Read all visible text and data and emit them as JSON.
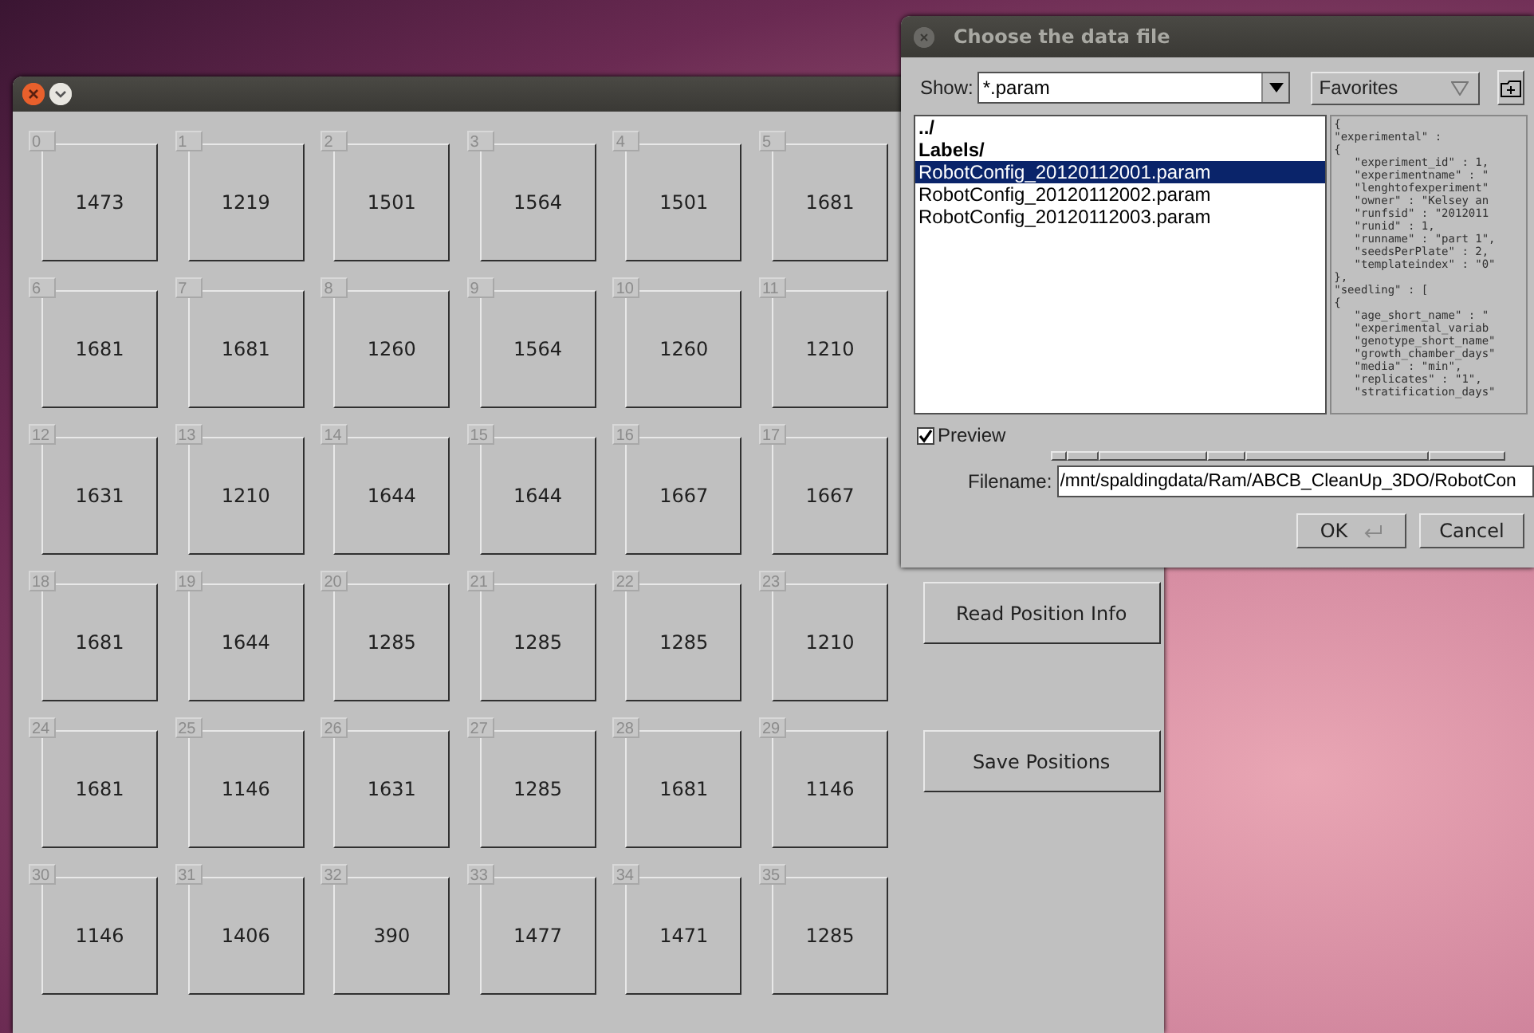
{
  "main_window": {
    "cells": [
      {
        "index": "0",
        "value": "1473"
      },
      {
        "index": "1",
        "value": "1219"
      },
      {
        "index": "2",
        "value": "1501"
      },
      {
        "index": "3",
        "value": "1564"
      },
      {
        "index": "4",
        "value": "1501"
      },
      {
        "index": "5",
        "value": "1681"
      },
      {
        "index": "6",
        "value": "1681"
      },
      {
        "index": "7",
        "value": "1681"
      },
      {
        "index": "8",
        "value": "1260"
      },
      {
        "index": "9",
        "value": "1564"
      },
      {
        "index": "10",
        "value": "1260"
      },
      {
        "index": "11",
        "value": "1210"
      },
      {
        "index": "12",
        "value": "1631"
      },
      {
        "index": "13",
        "value": "1210"
      },
      {
        "index": "14",
        "value": "1644"
      },
      {
        "index": "15",
        "value": "1644"
      },
      {
        "index": "16",
        "value": "1667"
      },
      {
        "index": "17",
        "value": "1667"
      },
      {
        "index": "18",
        "value": "1681"
      },
      {
        "index": "19",
        "value": "1644"
      },
      {
        "index": "20",
        "value": "1285"
      },
      {
        "index": "21",
        "value": "1285"
      },
      {
        "index": "22",
        "value": "1285"
      },
      {
        "index": "23",
        "value": "1210"
      },
      {
        "index": "24",
        "value": "1681"
      },
      {
        "index": "25",
        "value": "1146"
      },
      {
        "index": "26",
        "value": "1631"
      },
      {
        "index": "27",
        "value": "1285"
      },
      {
        "index": "28",
        "value": "1681"
      },
      {
        "index": "29",
        "value": "1146"
      },
      {
        "index": "30",
        "value": "1146"
      },
      {
        "index": "31",
        "value": "1406"
      },
      {
        "index": "32",
        "value": "390"
      },
      {
        "index": "33",
        "value": "1477"
      },
      {
        "index": "34",
        "value": "1471"
      },
      {
        "index": "35",
        "value": "1285"
      }
    ],
    "buttons": [
      "Read Position Info",
      "Save Positions"
    ]
  },
  "dialog": {
    "title": "Choose the data file",
    "show_label": "Show:",
    "filter": "*.param",
    "favorites": "Favorites",
    "files": [
      {
        "name": "../",
        "kind": "folder",
        "selected": false
      },
      {
        "name": "Labels/",
        "kind": "folder",
        "selected": false
      },
      {
        "name": "RobotConfig_20120112001.param",
        "kind": "file",
        "selected": true
      },
      {
        "name": "RobotConfig_20120112002.param",
        "kind": "file",
        "selected": false
      },
      {
        "name": "RobotConfig_20120112003.param",
        "kind": "file",
        "selected": false
      }
    ],
    "preview_lines": [
      "{",
      "\"experimental\" :",
      "{",
      "   \"experiment_id\" : 1,",
      "   \"experimentname\" : \"",
      "   \"lenghtofexperiment\"",
      "   \"owner\" : \"Kelsey an",
      "   \"runfsid\" : \"2012011",
      "   \"runid\" : 1,",
      "   \"runname\" : \"part 1\",",
      "   \"seedsPerPlate\" : 2,",
      "   \"templateindex\" : \"0\"",
      "},",
      "\"seedling\" : [",
      "{",
      "   \"age_short_name\" : \"",
      "   \"experimental_variab",
      "   \"genotype_short_name\"",
      "   \"growth_chamber_days\"",
      "   \"media\" : \"min\",",
      "   \"replicates\" : \"1\",",
      "   \"stratification_days\""
    ],
    "preview": {
      "label": "Preview",
      "checked": true
    },
    "filename_label": "Filename:",
    "filename": "/mnt/spaldingdata/Ram/ABCB_CleanUp_3DO/RobotCon",
    "ok": "OK",
    "cancel": "Cancel"
  }
}
